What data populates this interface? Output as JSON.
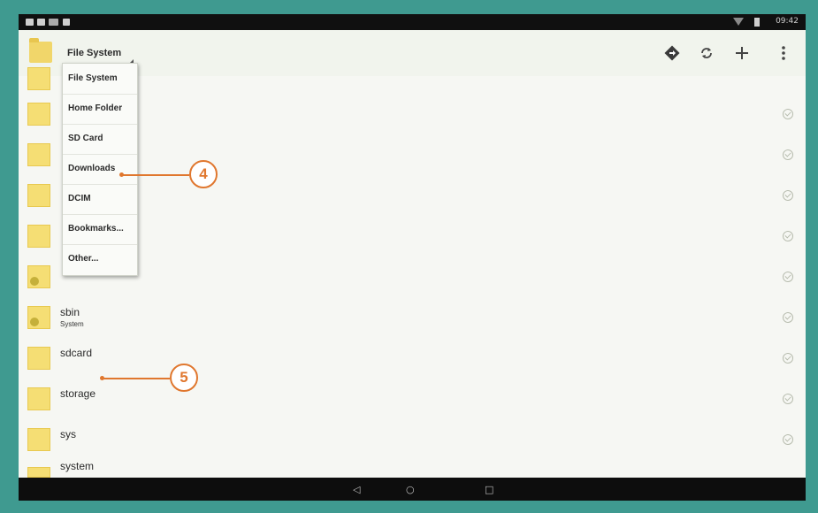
{
  "status_bar": {
    "time": "09:42"
  },
  "action_bar": {
    "title": "File System",
    "icons": [
      "navigate-icon",
      "refresh-icon",
      "add-icon",
      "overflow-menu-icon"
    ]
  },
  "dropdown": {
    "items": [
      {
        "label": "File System"
      },
      {
        "label": "Home Folder"
      },
      {
        "label": "SD Card"
      },
      {
        "label": "Downloads"
      },
      {
        "label": "DCIM"
      },
      {
        "label": "Bookmarks..."
      },
      {
        "label": "Other..."
      }
    ]
  },
  "rows": [
    {
      "name": "",
      "sub": ""
    },
    {
      "name": "",
      "sub": ""
    },
    {
      "name": "",
      "sub": ""
    },
    {
      "name": "",
      "sub": ""
    },
    {
      "name": "",
      "sub": ""
    },
    {
      "name": "sbin",
      "sub": "System"
    },
    {
      "name": "sdcard",
      "sub": ""
    },
    {
      "name": "storage",
      "sub": ""
    },
    {
      "name": "sys",
      "sub": ""
    },
    {
      "name": "system",
      "sub": ""
    }
  ],
  "callouts": {
    "downloads": "4",
    "storage": "5"
  },
  "colors": {
    "accent": "#e0772e",
    "frame": "#3f9a90",
    "folder": "#f5de74"
  }
}
